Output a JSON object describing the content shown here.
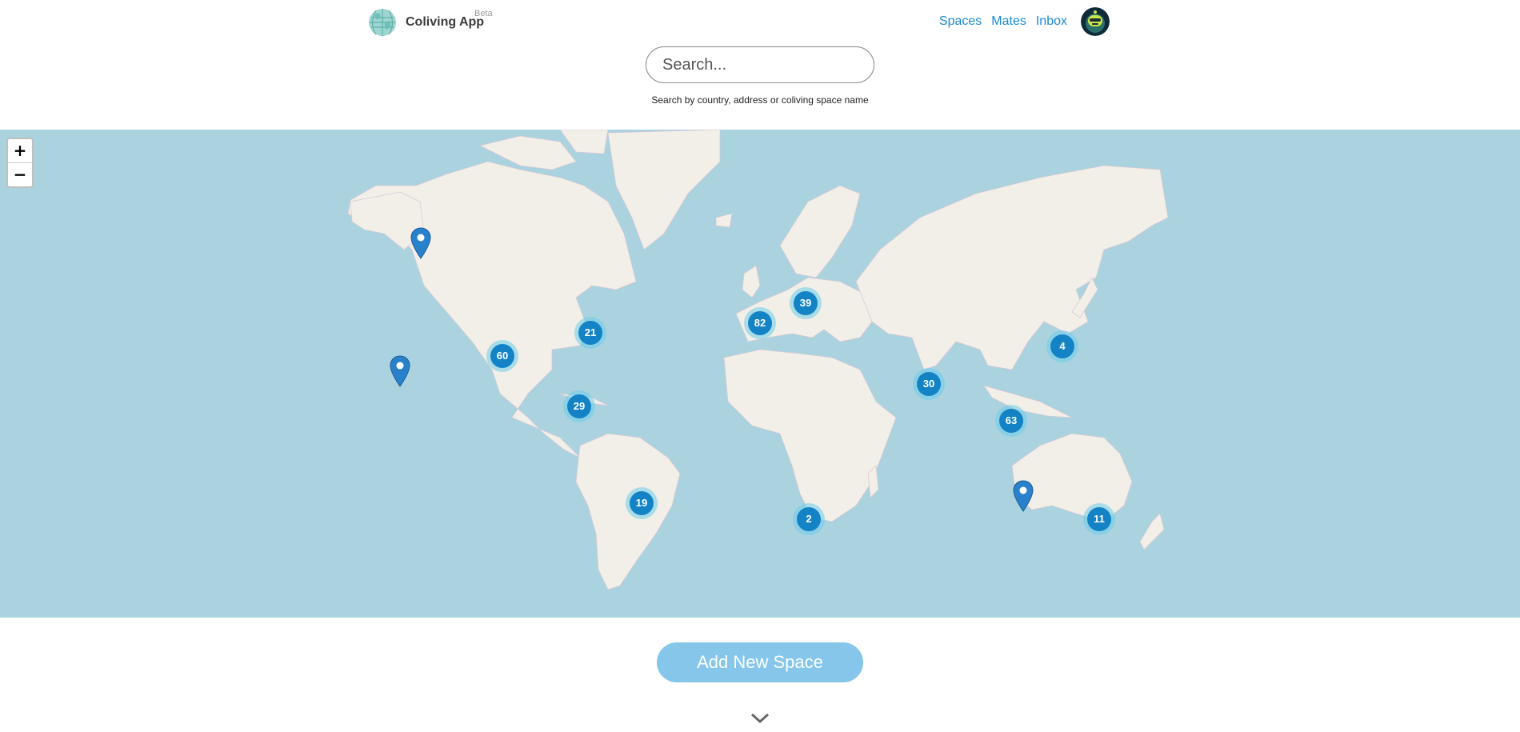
{
  "header": {
    "app_name": "Coliving App",
    "beta_label": "Beta",
    "nav": [
      {
        "label": "Spaces",
        "icon": ""
      },
      {
        "label": "Mates",
        "icon": ""
      },
      {
        "label": "Inbox",
        "icon": ""
      }
    ],
    "avatar_icon": "user-avatar-icon"
  },
  "search": {
    "placeholder": "Search...",
    "value": "",
    "hint": "Search by country, address or coliving space name"
  },
  "map": {
    "zoom_in_label": "+",
    "zoom_out_label": "−",
    "clusters": [
      {
        "count": "21",
        "region": "New York"
      },
      {
        "count": "60",
        "region": "California"
      },
      {
        "count": "29",
        "region": "Costa Rica"
      },
      {
        "count": "19",
        "region": "Brazil"
      },
      {
        "count": "82",
        "region": "Spain"
      },
      {
        "count": "39",
        "region": "Central Europe"
      },
      {
        "count": "2",
        "region": "South Africa"
      },
      {
        "count": "30",
        "region": "India"
      },
      {
        "count": "63",
        "region": "Southeast Asia"
      },
      {
        "count": "4",
        "region": "Japan"
      },
      {
        "count": "11",
        "region": "Australia"
      }
    ],
    "pins": [
      {
        "region": "Alaska"
      },
      {
        "region": "Hawaii"
      },
      {
        "region": "Western Australia"
      }
    ],
    "colors": {
      "water": "#aad3df",
      "land": "#f2efe9",
      "cluster": "#1383c6",
      "pin": "#2a81cb"
    }
  },
  "actions": {
    "add_space_label": "Add New Space",
    "scroll_icon": "chevron-down-icon"
  }
}
